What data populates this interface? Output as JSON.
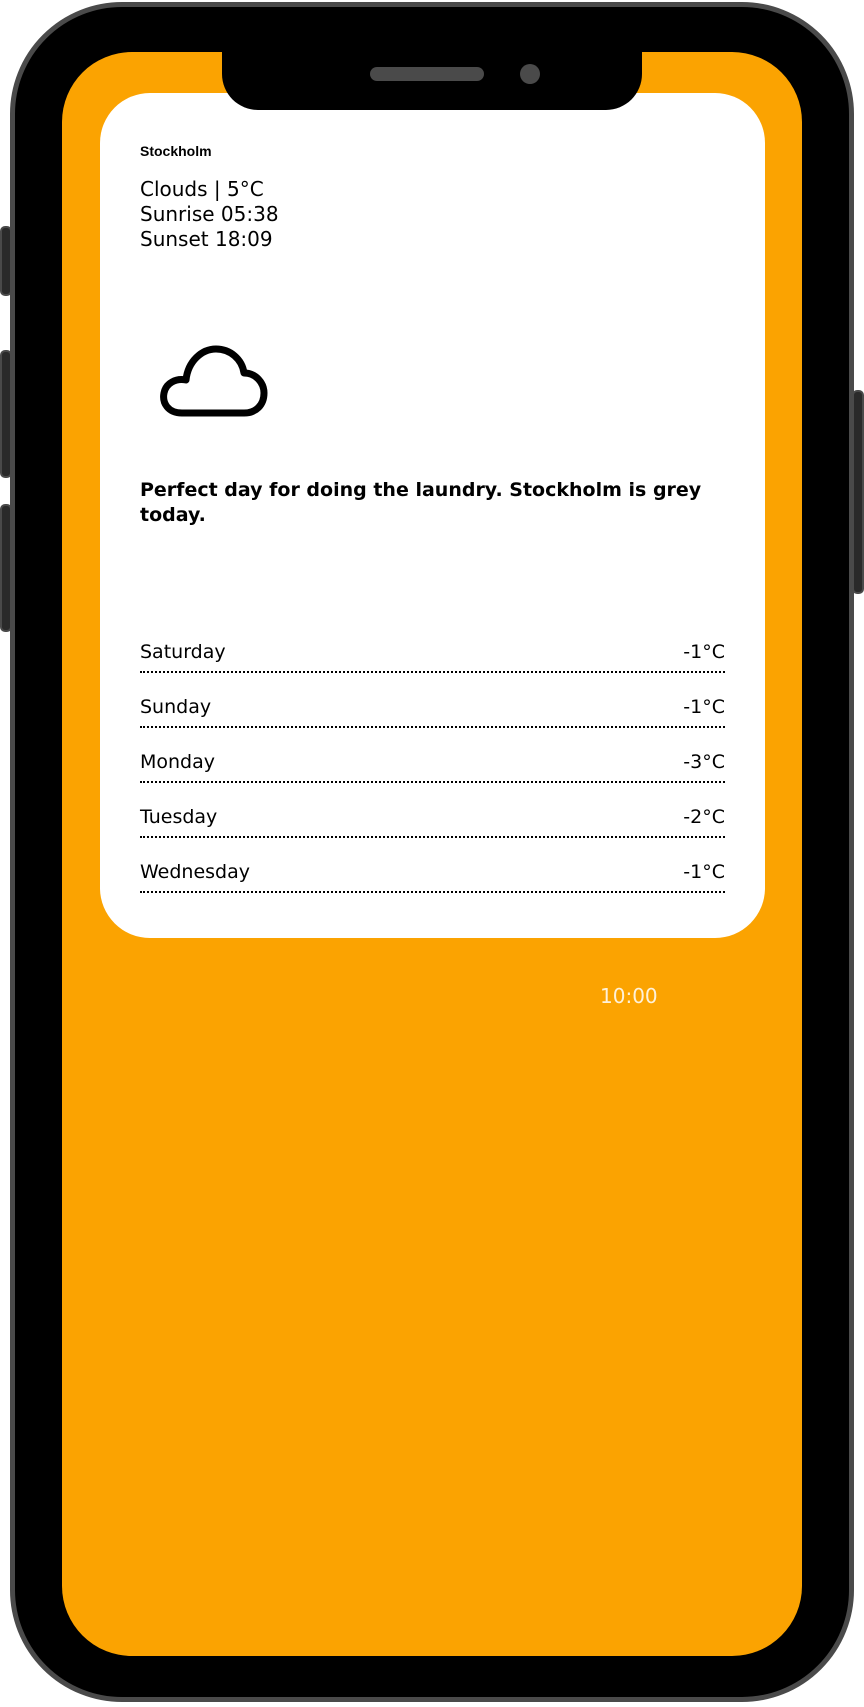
{
  "weather": {
    "city": "Stockholm",
    "conditions": "Clouds | 5°C",
    "sunrise": "Sunrise 05:38",
    "sunset": "Sunset 18:09",
    "icon": "cloud-icon",
    "message": "Perfect day for doing the laundry. Stockholm is grey today.",
    "forecast": [
      {
        "day": "Saturday",
        "temp": "-1°C"
      },
      {
        "day": "Sunday",
        "temp": "-1°C"
      },
      {
        "day": "Monday",
        "temp": "-3°C"
      },
      {
        "day": "Tuesday",
        "temp": "-2°C"
      },
      {
        "day": "Wednesday",
        "temp": "-1°C"
      }
    ]
  },
  "status": {
    "time": "10:00"
  },
  "colors": {
    "background": "#FBA301",
    "card": "#FFFFFF",
    "text": "#000000",
    "frame": "#000000",
    "frame_border": "#4A4A4A"
  }
}
